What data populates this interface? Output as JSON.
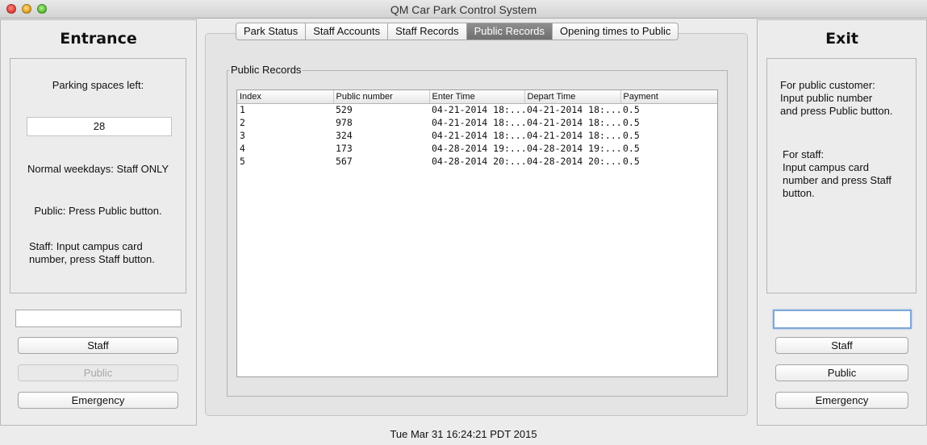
{
  "window": {
    "title": "QM Car Park Control System"
  },
  "entrance": {
    "title": "Entrance",
    "spaces_label": "Parking spaces left:",
    "spaces_value": "28",
    "weekday_note": "Normal weekdays: Staff ONLY",
    "public_note": "Public: Press Public button.",
    "staff_note_line1": "Staff: Input campus card",
    "staff_note_line2": "number, press Staff button.",
    "input_value": "",
    "staff_button": "Staff",
    "public_button": "Public",
    "emergency_button": "Emergency"
  },
  "tabs": [
    "Park Status",
    "Staff Accounts",
    "Staff Records",
    "Public Records",
    "Opening times to Public"
  ],
  "active_tab": "Public Records",
  "public_records": {
    "group_title": "Public Records",
    "columns": [
      "Index",
      "Public number",
      "Enter Time",
      "Depart Time",
      "Payment"
    ],
    "rows": [
      [
        "1",
        "529",
        "04-21-2014 18:...",
        "04-21-2014 18:...",
        "0.5"
      ],
      [
        "2",
        "978",
        "04-21-2014 18:...",
        "04-21-2014 18:...",
        "0.5"
      ],
      [
        "3",
        "324",
        "04-21-2014 18:...",
        "04-21-2014 18:...",
        "0.5"
      ],
      [
        "4",
        "173",
        "04-28-2014 19:...",
        "04-28-2014 19:...",
        "0.5"
      ],
      [
        "5",
        "567",
        "04-28-2014 20:...",
        "04-28-2014 20:...",
        "0.5"
      ]
    ]
  },
  "exit": {
    "title": "Exit",
    "public_line1": "For public customer:",
    "public_line2": "Input public number",
    "public_line3": "and press Public button.",
    "staff_line1": "For staff:",
    "staff_line2": "Input campus card",
    "staff_line3": "number and press Staff",
    "staff_line4": "button.",
    "input_value": "",
    "staff_button": "Staff",
    "public_button": "Public",
    "emergency_button": "Emergency"
  },
  "status": {
    "datetime": "Tue Mar 31 16:24:21 PDT 2015"
  }
}
